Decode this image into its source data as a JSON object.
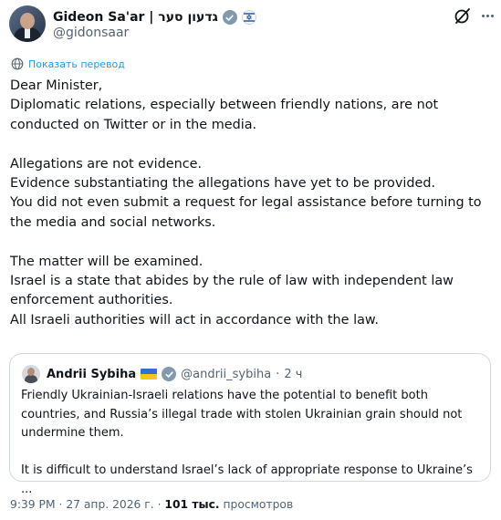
{
  "author": {
    "name": "Gideon Sa'ar | גדעון סער",
    "handle": "@gidonsaar",
    "badge_color": "#829aab",
    "affiliation_icon": "israel-flag-icon"
  },
  "actions": {
    "grok_icon": "grok-icon",
    "more_icon": "more-icon"
  },
  "translate_label": "Показать перевод",
  "tweet_lines": [
    "Dear Minister,",
    "Diplomatic relations, especially between friendly nations, are not",
    "conducted on Twitter or in the media.",
    "",
    "Allegations are not evidence.",
    "Evidence substantiating the allegations have yet to be provided.",
    "You did not even submit a request for legal assistance before turning to",
    "the media and social networks.",
    "",
    "The matter will be examined.",
    "Israel is a state that abides by the rule of law with independent law",
    "enforcement authorities.",
    "All Israeli authorities will act in accordance with the law."
  ],
  "quote": {
    "name": "Andrii Sybiha",
    "flag_icon": "ukraine-flag-icon",
    "badge_color": "#829aab",
    "handle": "@andrii_sybiha",
    "separator": "·",
    "time": "2 ч",
    "lines": [
      "Friendly Ukrainian-Israeli relations have the potential to benefit both",
      "countries, and Russia’s illegal trade with stolen Ukrainian grain should not",
      "undermine them.",
      "",
      "It is difficult to understand Israel’s lack of appropriate response to Ukraine’s ..."
    ]
  },
  "footer": {
    "time": "9:39 PM",
    "sep1": "·",
    "date": "27 апр. 2026 г.",
    "sep2": "·",
    "views": "101 тыс.",
    "views_label": "просмотров"
  },
  "colors": {
    "text": "#0f1419",
    "secondary": "#536471",
    "link": "#1d9bf0",
    "border": "#cfd9de"
  }
}
